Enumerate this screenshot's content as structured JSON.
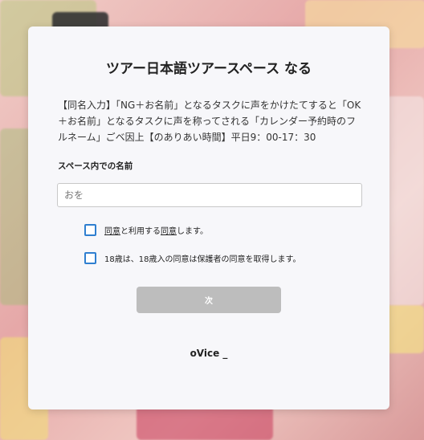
{
  "dialog": {
    "title": "ツアー日本語ツアースペース なる",
    "description": "【同名入力】「NG＋お名前」となるタスクに声をかけたてすると「OK＋お名前」となるタスクに声を称ってされる「カレンダー予約時のフルネーム」ごベ因上【のありあい時間】平日9：00-17：30",
    "name_field": {
      "label": "スペース内での名前",
      "placeholder": "おを",
      "value": ""
    },
    "checkboxes": [
      {
        "checked": false,
        "link1": "同意",
        "middle": "と利用する",
        "link2": "同意",
        "tail": "します。"
      },
      {
        "checked": false,
        "text": "18歳は、18歳入の同意は保護者の同意を取得します。"
      }
    ],
    "next_label": "次",
    "brand": "oVice _"
  },
  "colors": {
    "checkbox_border": "#2f7fd0",
    "button_disabled": "#bdbdbd",
    "modal_bg": "#f7f7fa"
  }
}
